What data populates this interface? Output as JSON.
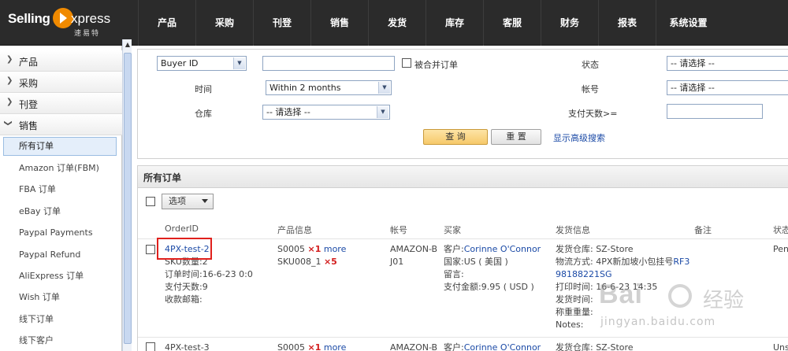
{
  "app": {
    "logo_main_left": "Selling",
    "logo_main_right": "xpress",
    "logo_sub": "速易特"
  },
  "nav": [
    "产品",
    "采购",
    "刊登",
    "销售",
    "发货",
    "库存",
    "客服",
    "财务",
    "报表",
    "系统设置"
  ],
  "sidebar": {
    "sections": [
      {
        "label": "产品",
        "expanded": false
      },
      {
        "label": "采购",
        "expanded": false
      },
      {
        "label": "刊登",
        "expanded": false
      },
      {
        "label": "销售",
        "expanded": true
      }
    ],
    "sales_items": [
      "所有订单",
      "Amazon 订单(FBM)",
      "FBA 订单",
      "eBay 订单",
      "Paypal Payments",
      "Paypal Refund",
      "AliExpress 订单",
      "Wish 订单",
      "线下订单",
      "线下客户"
    ],
    "active_item": "所有订单"
  },
  "search": {
    "field_select": "Buyer ID",
    "merged_label": "被合并订单",
    "time_label": "时间",
    "time_value": "Within 2 months",
    "warehouse_label": "仓库",
    "warehouse_value": "-- 请选择 --",
    "status_label": "状态",
    "status_value": "-- 请选择 --",
    "account_label": "帐号",
    "account_value": "-- 请选择 --",
    "paydays_label": "支付天数>=",
    "query_button": "查 询",
    "reset_button": "重 置",
    "advanced_link": "显示高级搜索"
  },
  "orders": {
    "title": "所有订单",
    "options_button": "选项",
    "columns": [
      "OrderID",
      "产品信息",
      "帐号",
      "买家",
      "发货信息",
      "备注",
      "状态"
    ],
    "rows": [
      {
        "order_id": "4PX-test-2",
        "details": [
          "SKU数量:2",
          "订单时间:16-6-23 0:0",
          "支付天数:9",
          "收款邮箱:"
        ],
        "products": [
          {
            "sku": "S0005",
            "qty": "×1",
            "more": "more"
          },
          {
            "sku": "SKU008_1",
            "qty": "×5",
            "more": ""
          }
        ],
        "account_line1": "AMAZON-B",
        "account_line2": "J01",
        "buyer_label": "客户:",
        "buyer_name": "Corinne O'Connor",
        "country": "国家:US ( 美国 )",
        "message": "留言:",
        "paid": "支付金额:9.95 ( USD )",
        "ship_warehouse": "发货仓库: SZ-Store",
        "ship_method_label": "物流方式: 4PX新加坡小包挂号",
        "tracking": "RF398188221SG",
        "tracking_line1": "RF3",
        "tracking_line2": "98188221SG",
        "print_time": "打印时间: 16-6-23 14:35",
        "ship_time": "发货时间:",
        "weight": "称重重量:",
        "notes": "Notes:",
        "status": "Pen"
      },
      {
        "order_id": "4PX-test-3",
        "products": [
          {
            "sku": "S0005",
            "qty": "×1",
            "more": "more"
          }
        ],
        "account_line1": "AMAZON-B",
        "buyer_label": "客户:",
        "buyer_name": "Corinne O'Connor",
        "ship_warehouse": "发货仓库: SZ-Store",
        "status": "Uns"
      }
    ]
  },
  "watermark": {
    "brand": "Bai",
    "brand2": "du",
    "cn": "经验",
    "url": "jingyan.baidu.com"
  }
}
